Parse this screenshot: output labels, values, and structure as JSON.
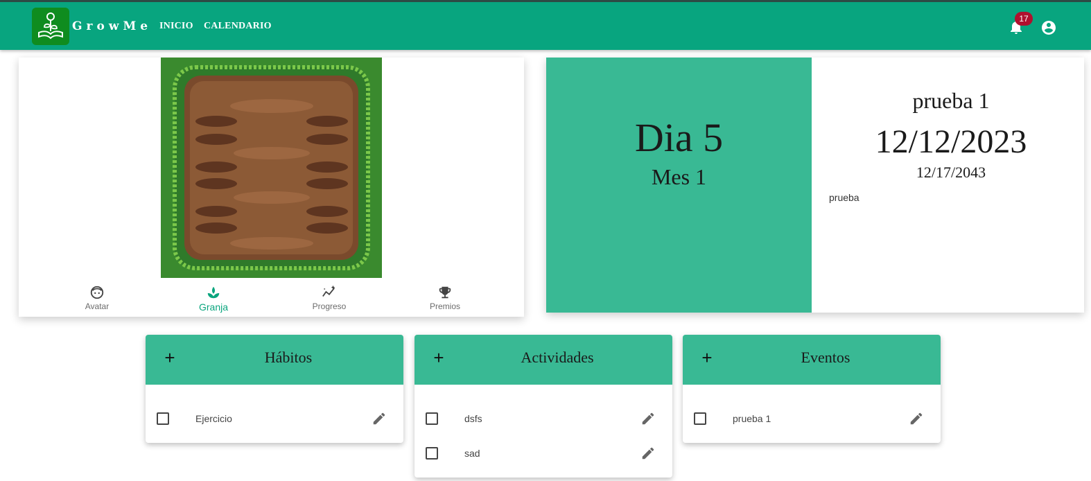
{
  "header": {
    "brand": "GrowMe",
    "nav": [
      "INICIO",
      "CALENDARIO"
    ],
    "notification_count": "17",
    "colors": {
      "bar": "#08a57f",
      "badge": "#b0102e",
      "logo_bg": "#0f8c1f"
    }
  },
  "farm": {
    "nav": [
      {
        "label": "Avatar",
        "icon": "face-icon",
        "active": false
      },
      {
        "label": "Granja",
        "icon": "sprout-icon",
        "active": true
      },
      {
        "label": "Progreso",
        "icon": "trend-icon",
        "active": false
      },
      {
        "label": "Premios",
        "icon": "trophy-icon",
        "active": false
      }
    ]
  },
  "date_panel": {
    "day": "Dia 5",
    "month": "Mes 1",
    "event_title": "prueba 1",
    "event_date": "12/12/2023",
    "event_end": "12/17/2043",
    "event_desc": "prueba",
    "accent": "#39b994"
  },
  "lists": [
    {
      "title": "Hábitos",
      "items": [
        "Ejercicio"
      ]
    },
    {
      "title": "Actividades",
      "items": [
        "dsfs",
        "sad"
      ]
    },
    {
      "title": "Eventos",
      "items": [
        "prueba 1"
      ]
    }
  ]
}
